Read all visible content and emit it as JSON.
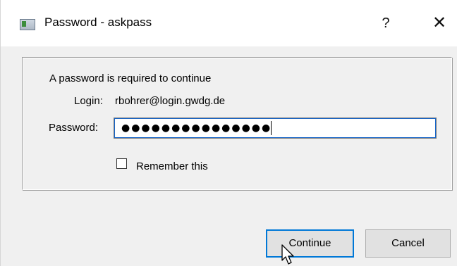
{
  "window": {
    "title": "Password - askpass",
    "help_label": "?",
    "close_label": "✕"
  },
  "form": {
    "message": "A password is required to continue",
    "login_label": "Login:",
    "login_value": "rbohrer@login.gwdg.de",
    "password_label": "Password:",
    "password_masked": "●●●●●●●●●●●●●●●",
    "remember_label": "Remember this",
    "remember_checked": false
  },
  "buttons": {
    "continue_label": "Continue",
    "cancel_label": "Cancel"
  }
}
